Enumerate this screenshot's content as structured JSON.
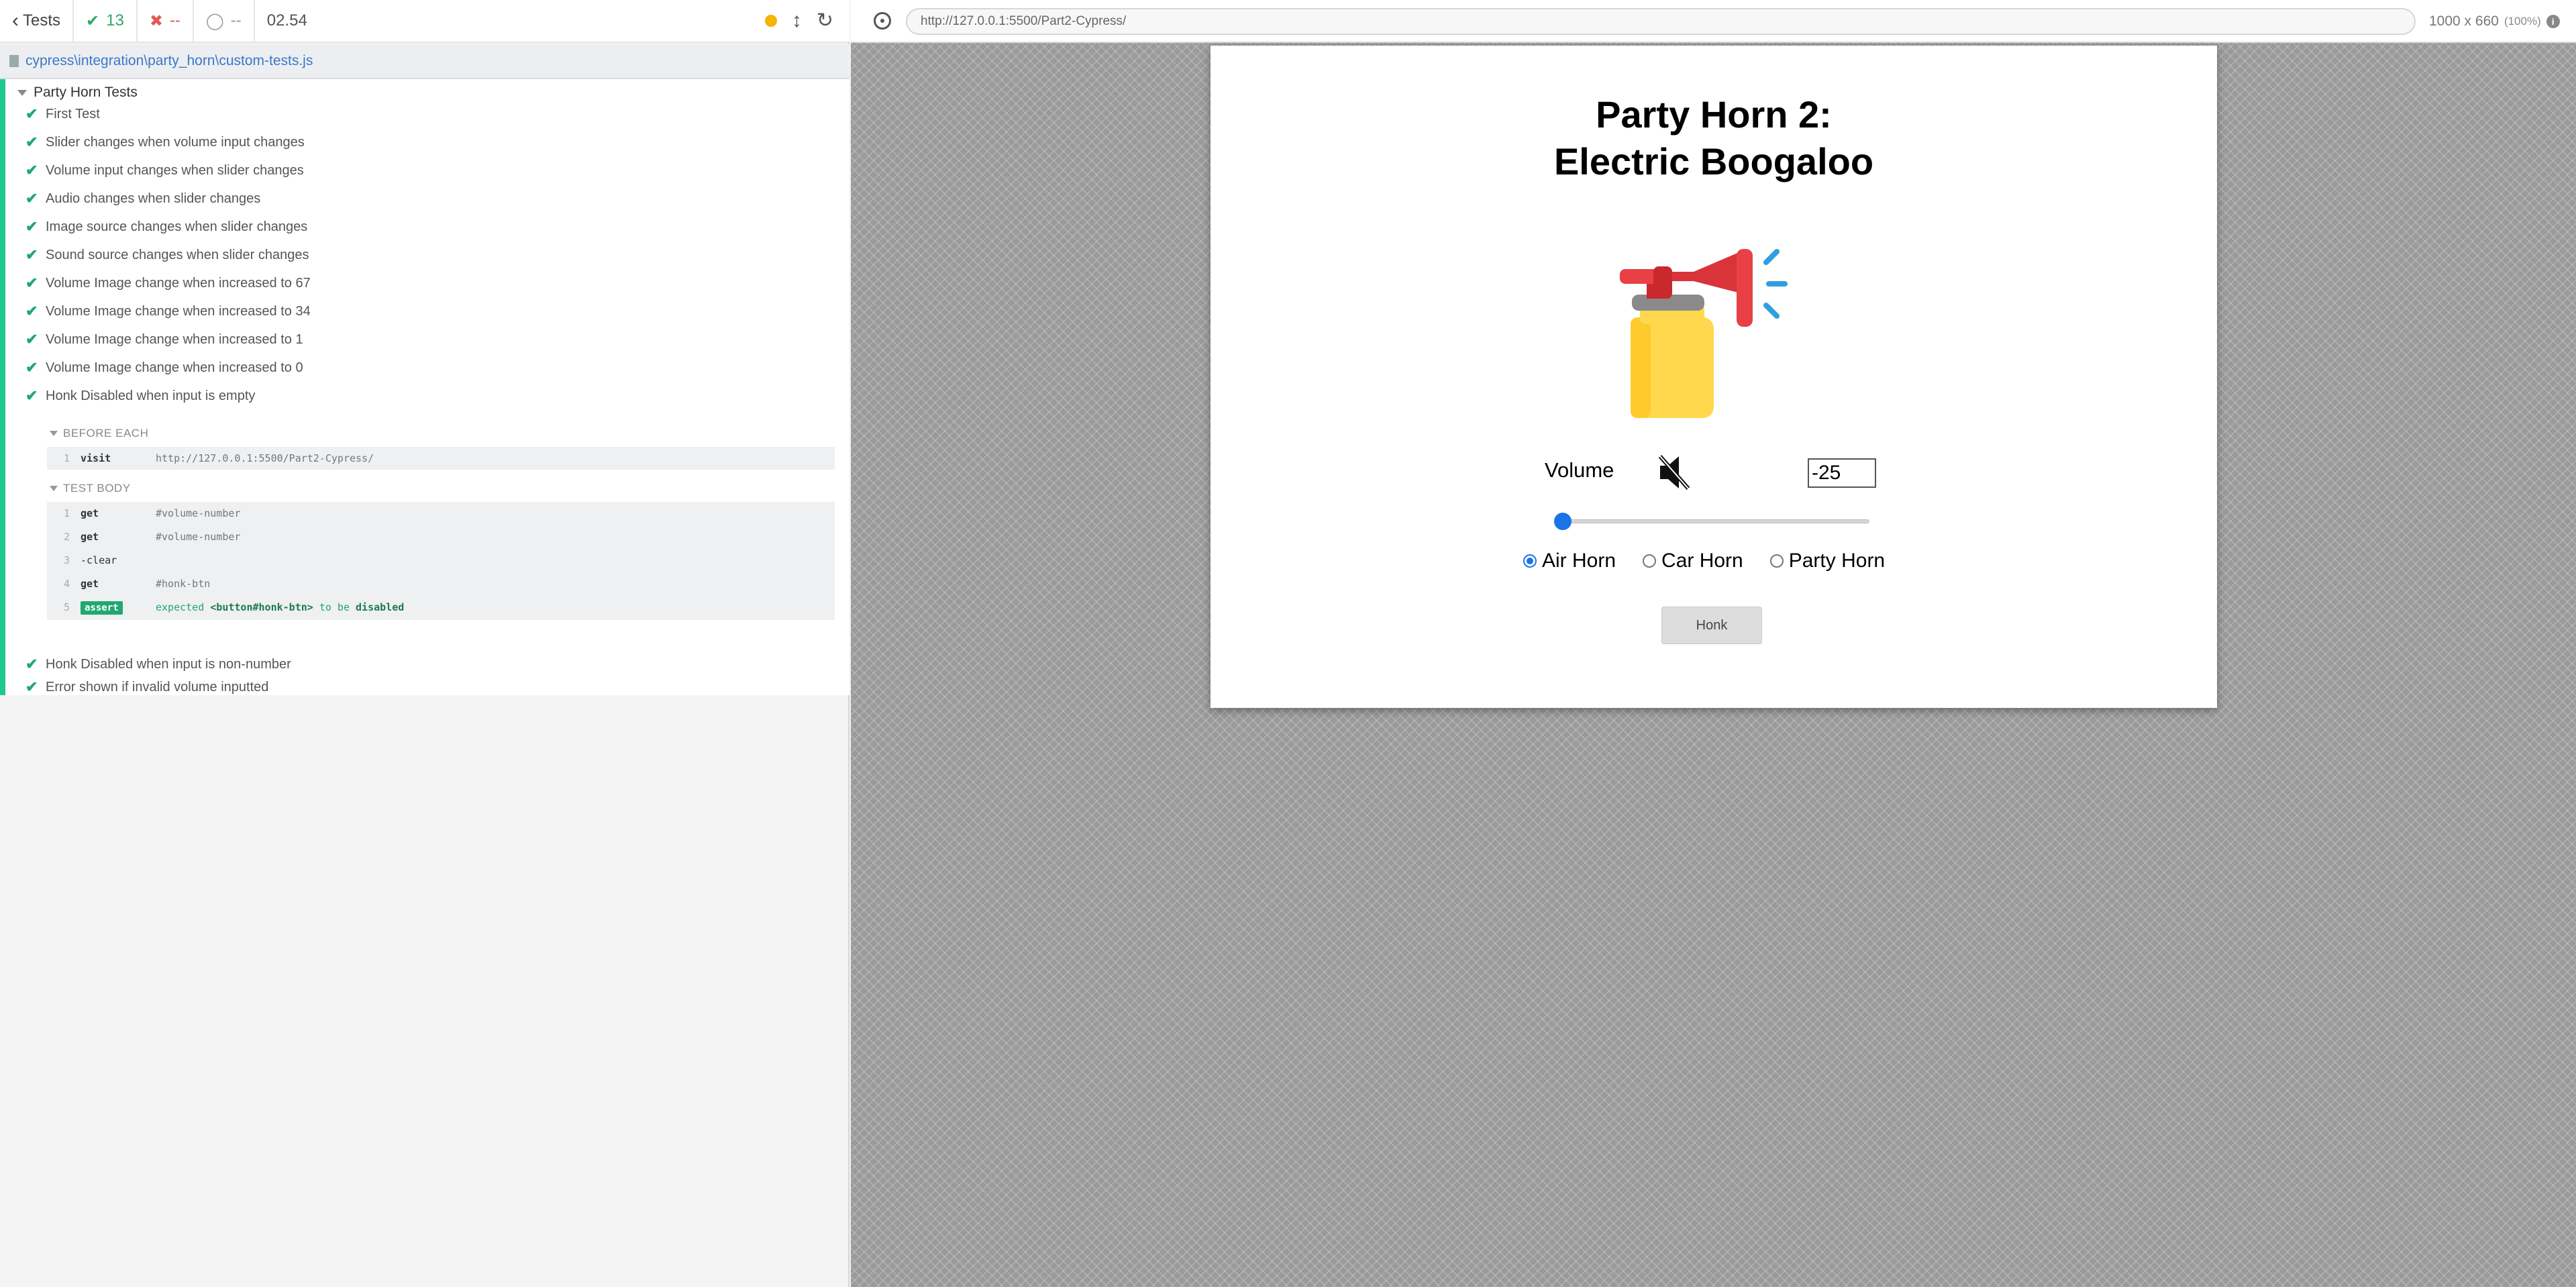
{
  "reporter": {
    "tests_label": "Tests",
    "passed": "13",
    "failed": "--",
    "pending": "--",
    "duration": "02.54",
    "spec_path": "cypress\\integration\\party_horn\\custom-tests.js",
    "suite_title": "Party Horn Tests",
    "tests_before": [
      "First Test",
      "Slider changes when volume input changes",
      "Volume input changes when slider changes",
      "Audio changes when slider changes",
      "Image source changes when slider changes",
      "Sound source changes when slider changes",
      "Volume Image change when increased to 67",
      "Volume Image change when increased to 34",
      "Volume Image change when increased to 1",
      "Volume Image change when increased to 0",
      "Honk Disabled when input is empty"
    ],
    "before_each_title": "BEFORE EACH",
    "before_each": [
      {
        "num": "1",
        "name": "visit",
        "msg": "http://127.0.0.1:5500/Part2-Cypress/"
      }
    ],
    "test_body_title": "TEST BODY",
    "test_body": [
      {
        "num": "1",
        "name": "get",
        "msg": "#volume-number"
      },
      {
        "num": "2",
        "name": "get",
        "msg": "#volume-number"
      },
      {
        "num": "3",
        "name": "-clear",
        "msg": ""
      },
      {
        "num": "4",
        "name": "get",
        "msg": "#honk-btn"
      }
    ],
    "assert_row": {
      "num": "5",
      "name": "assert",
      "expected": "expected",
      "subject": "<button#honk-btn>",
      "to_be": "to be",
      "state": "disabled"
    },
    "tests_after": [
      "Honk Disabled when input is non-number",
      "Error shown if invalid volume inputted"
    ]
  },
  "aut": {
    "url": "http://127.0.0.1:5500/Part2-Cypress/",
    "viewport": "1000 x 660",
    "zoom": "(100%)"
  },
  "app": {
    "title_line1": "Party Horn 2:",
    "title_line2": "Electric Boogaloo",
    "volume_label": "Volume",
    "volume_value": "-25",
    "slider_value": 0,
    "horns": [
      "Air Horn",
      "Car Horn",
      "Party Horn"
    ],
    "selected_horn": "Air Horn",
    "honk_label": "Honk",
    "honk_disabled": true
  },
  "colors": {
    "pass": "#1fa870",
    "fail": "#e45858",
    "accent": "#1a73e8",
    "link": "#3a78c7"
  }
}
